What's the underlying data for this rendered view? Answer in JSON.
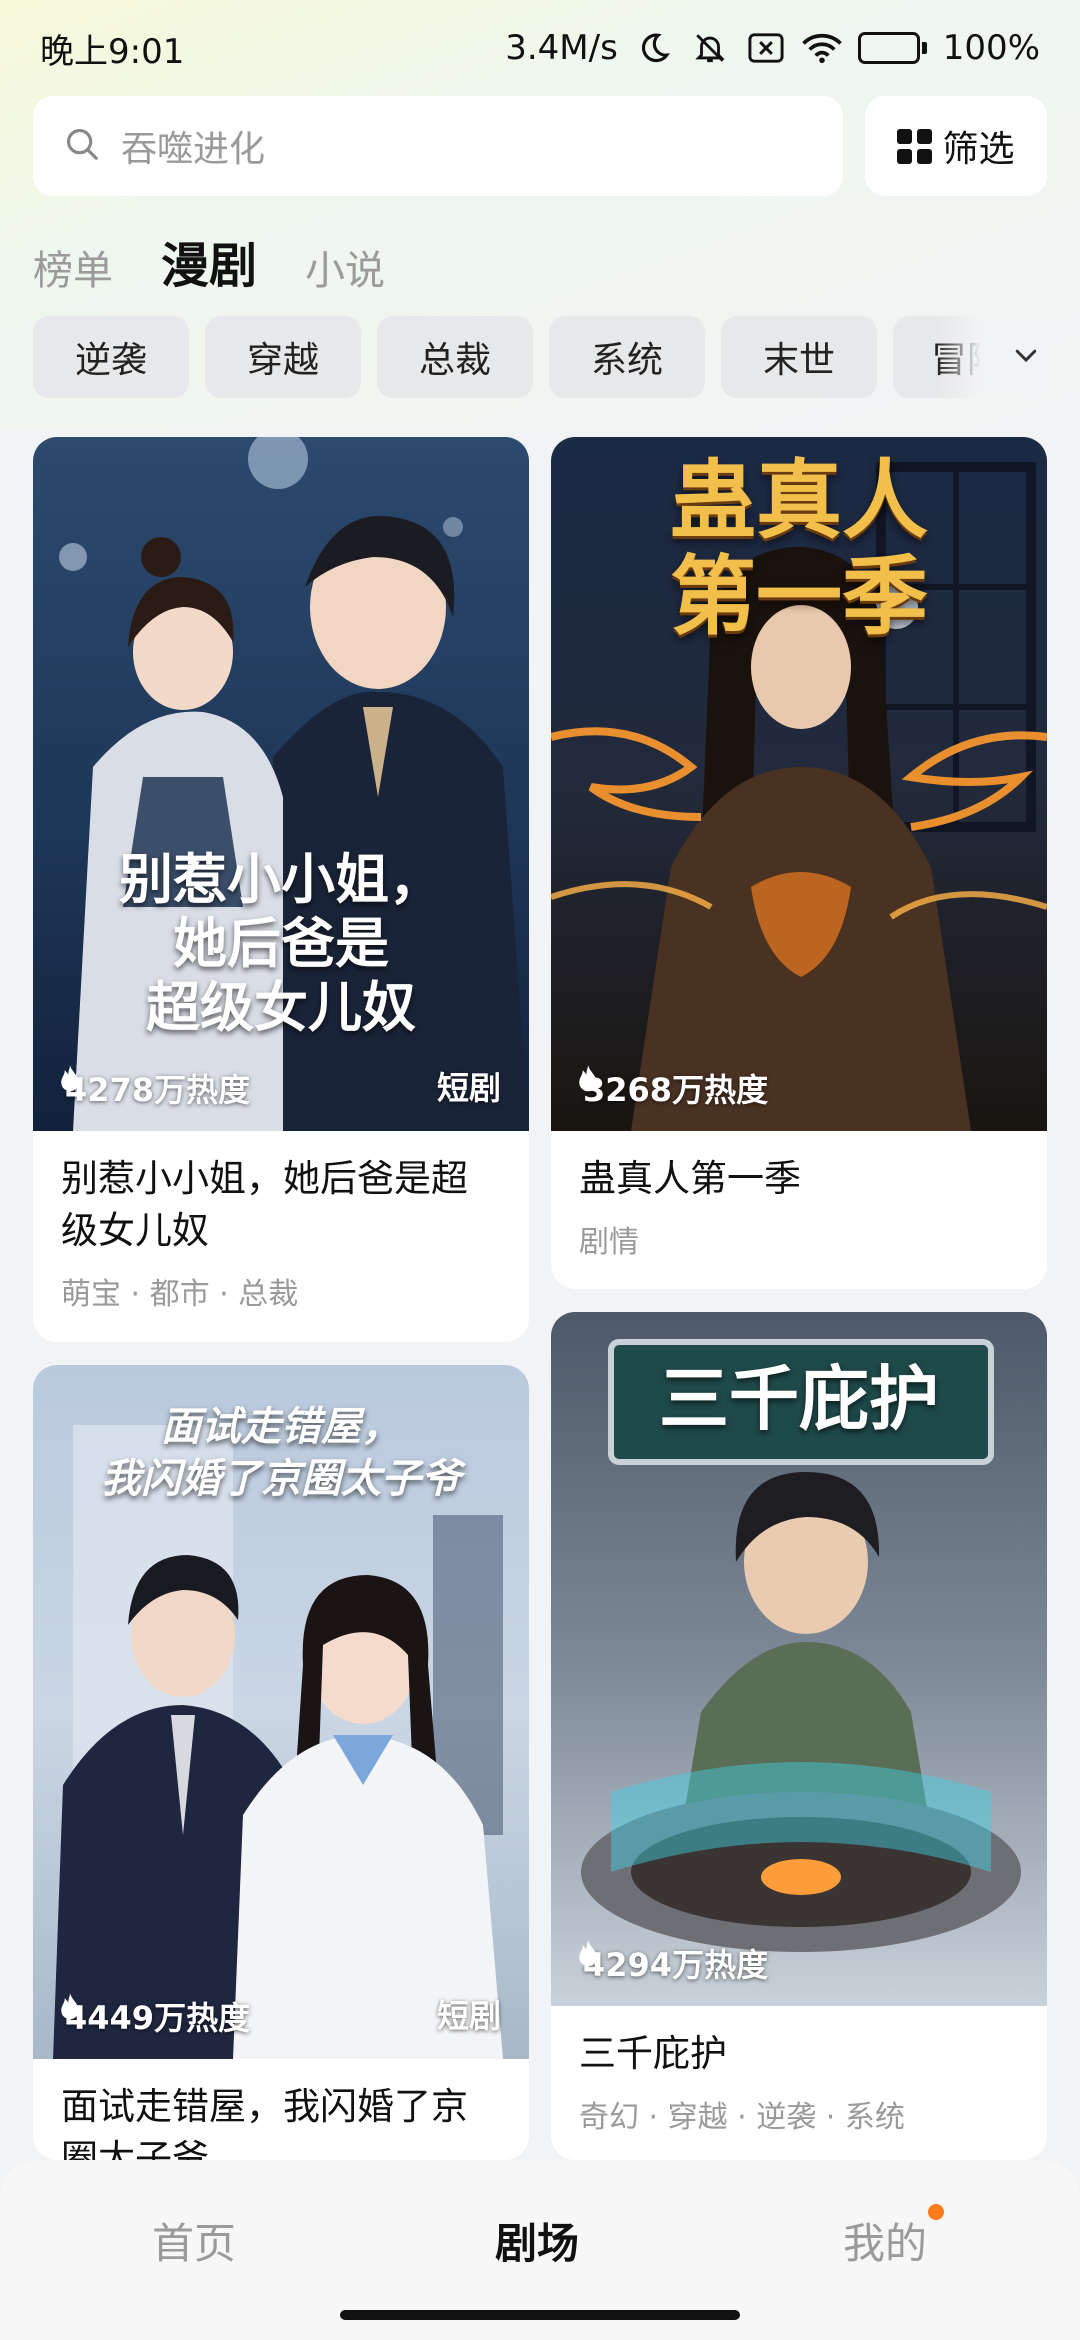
{
  "status_bar": {
    "time": "晚上9:01",
    "network_speed": "3.4M/s",
    "battery": "100%"
  },
  "search": {
    "placeholder": "吞噬进化",
    "filter_label": "筛选"
  },
  "tabs": [
    {
      "label": "榜单",
      "active": false
    },
    {
      "label": "漫剧",
      "active": true
    },
    {
      "label": "小说",
      "active": false
    }
  ],
  "chips": [
    "逆袭",
    "穿越",
    "总裁",
    "系统",
    "末世",
    "冒险"
  ],
  "cards": [
    {
      "poster_text": "别惹小小姐，\n她后爸是\n超级女儿奴",
      "heat": "4278万热度",
      "badge": "短剧",
      "title": "别惹小小姐，她后爸是超级女儿奴",
      "tags": "萌宝 · 都市 · 总裁"
    },
    {
      "poster_text": "蛊真人\n第一季",
      "heat": "3268万热度",
      "badge": "",
      "title": "蛊真人第一季",
      "tags": "剧情"
    },
    {
      "poster_text": "面试走错屋，\n我闪婚了京圈太子爷",
      "heat": "4449万热度",
      "badge": "短剧",
      "title": "面试走错屋，我闪婚了京圈太子爷",
      "tags": ""
    },
    {
      "poster_text": "三千庇护",
      "heat": "4294万热度",
      "badge": "",
      "title": "三千庇护",
      "tags": "奇幻 · 穿越 · 逆袭 · 系统"
    }
  ],
  "bottom_nav": [
    {
      "label": "首页",
      "active": false
    },
    {
      "label": "剧场",
      "active": true
    },
    {
      "label": "我的",
      "active": false,
      "has_dot": true
    }
  ],
  "colors": {
    "accent_dot": "#ff7a1a",
    "battery": "#2fb24c"
  }
}
